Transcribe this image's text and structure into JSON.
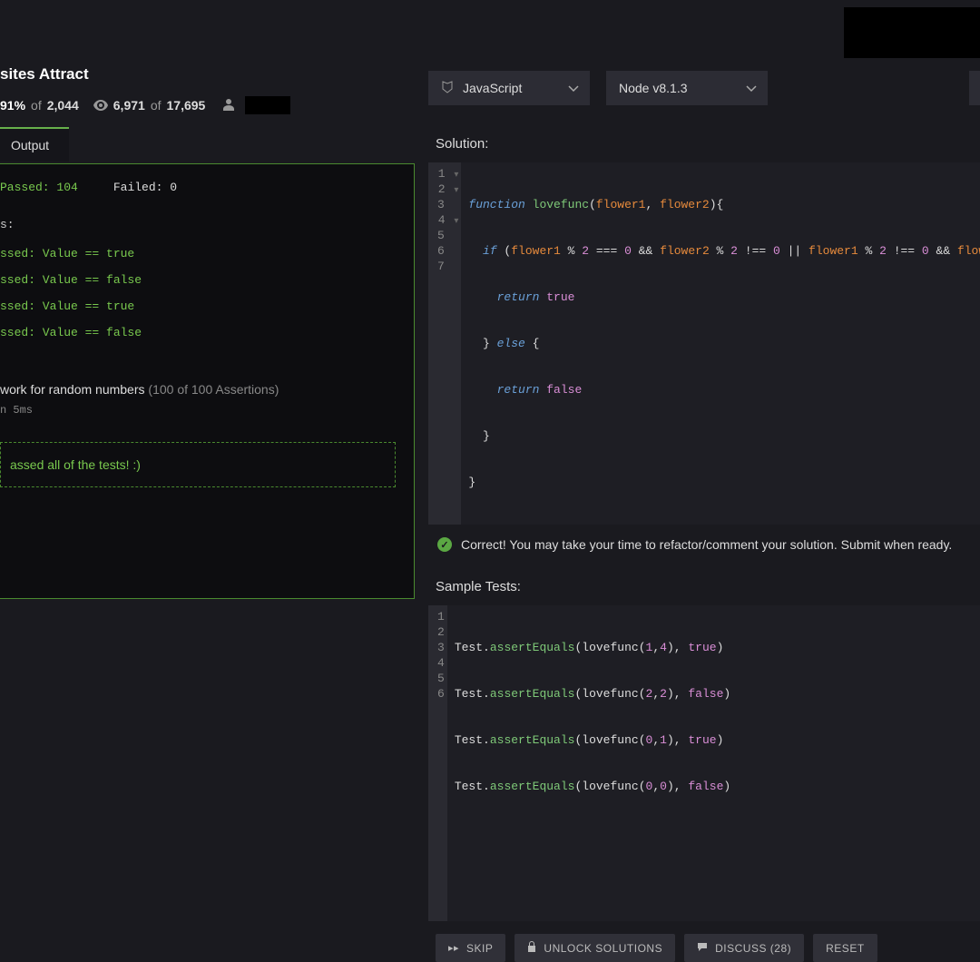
{
  "header": {
    "title": "sites Attract",
    "pass_rate": "91%",
    "of1": "of",
    "total1": "2,044",
    "stat2a": "6,971",
    "of2": "of",
    "stat2b": "17,695"
  },
  "dropdowns": {
    "language": "JavaScript",
    "runtime": "Node v8.1.3"
  },
  "tabs": {
    "output": "Output"
  },
  "left": {
    "passed_label": "Passed:",
    "passed_count": "104",
    "failed_label": "Failed:",
    "failed_count": "0",
    "section": "s:",
    "t1": "ssed: Value == true",
    "t2": "ssed: Value == false",
    "t3": "ssed: Value == true",
    "t4": "ssed: Value == false",
    "random_label": "work for random numbers",
    "assertions": "(100 of 100 Assertions)",
    "time": "n 5ms",
    "success": "assed all of the tests! :)"
  },
  "solution": {
    "header": "Solution:",
    "lines": {
      "l1_kw": "function",
      "l1_fn": "lovefunc",
      "l1_p1": "flower1",
      "l1_p2": "flower2",
      "l2_kw": "if",
      "l2_p1": "flower1",
      "l2_n2": "2",
      "l2_eq": "===",
      "l2_n0": "0",
      "l2_and": "&&",
      "l2_p2": "flower2",
      "l2_neq": "!==",
      "l2_or": "||",
      "l2_p3": "flower1",
      "l2_tail": "flow",
      "l3_kw": "return",
      "l3_b": "true",
      "l4_else": "else",
      "l5_kw": "return",
      "l5_b": "false"
    }
  },
  "feedback": "Correct! You may take your time to refactor/comment your solution. Submit when ready.",
  "tests": {
    "header": "Sample Tests:",
    "obj": "Test",
    "method": "assertEquals",
    "fn": "lovefunc",
    "t1a": "1",
    "t1b": "4",
    "t1r": "true",
    "t2a": "2",
    "t2b": "2",
    "t2r": "false",
    "t3a": "0",
    "t3b": "1",
    "t3r": "true",
    "t4a": "0",
    "t4b": "0",
    "t4r": "false"
  },
  "buttons": {
    "skip": "SKIP",
    "unlock": "UNLOCK SOLUTIONS",
    "discuss": "DISCUSS (28)",
    "reset": "RESET"
  }
}
